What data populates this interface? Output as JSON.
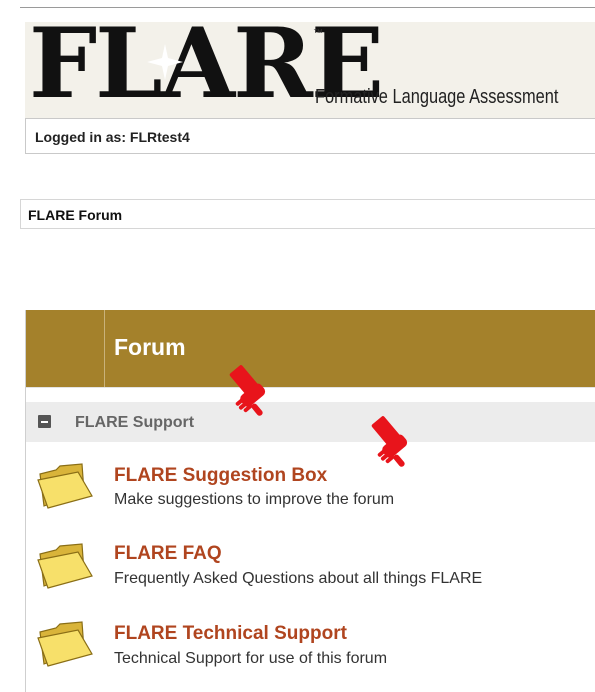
{
  "logo": {
    "name": "FLARE",
    "trademark": "™",
    "tagline": "Formative Language Assessment"
  },
  "session": {
    "logged_in_text": "Logged in as: FLRtest4"
  },
  "breadcrumb": {
    "label": "FLARE Forum"
  },
  "forum_table": {
    "header": "Forum",
    "category": {
      "label": "FLARE Support"
    },
    "forums": [
      {
        "title": "FLARE Suggestion Box",
        "description": "Make suggestions to improve the forum",
        "icon": "folder-icon"
      },
      {
        "title": "FLARE FAQ",
        "description": "Frequently Asked Questions about all things FLARE",
        "icon": "folder-icon"
      },
      {
        "title": "FLARE Technical Support",
        "description": "Technical Support for use of this forum",
        "icon": "folder-icon"
      }
    ]
  },
  "annotations": {
    "icon": "pointing-hand-icon",
    "color": "#e8141b"
  },
  "colors": {
    "header_bg": "#a4812b",
    "forum_link": "#b0451f",
    "category_bg": "#ececec"
  }
}
